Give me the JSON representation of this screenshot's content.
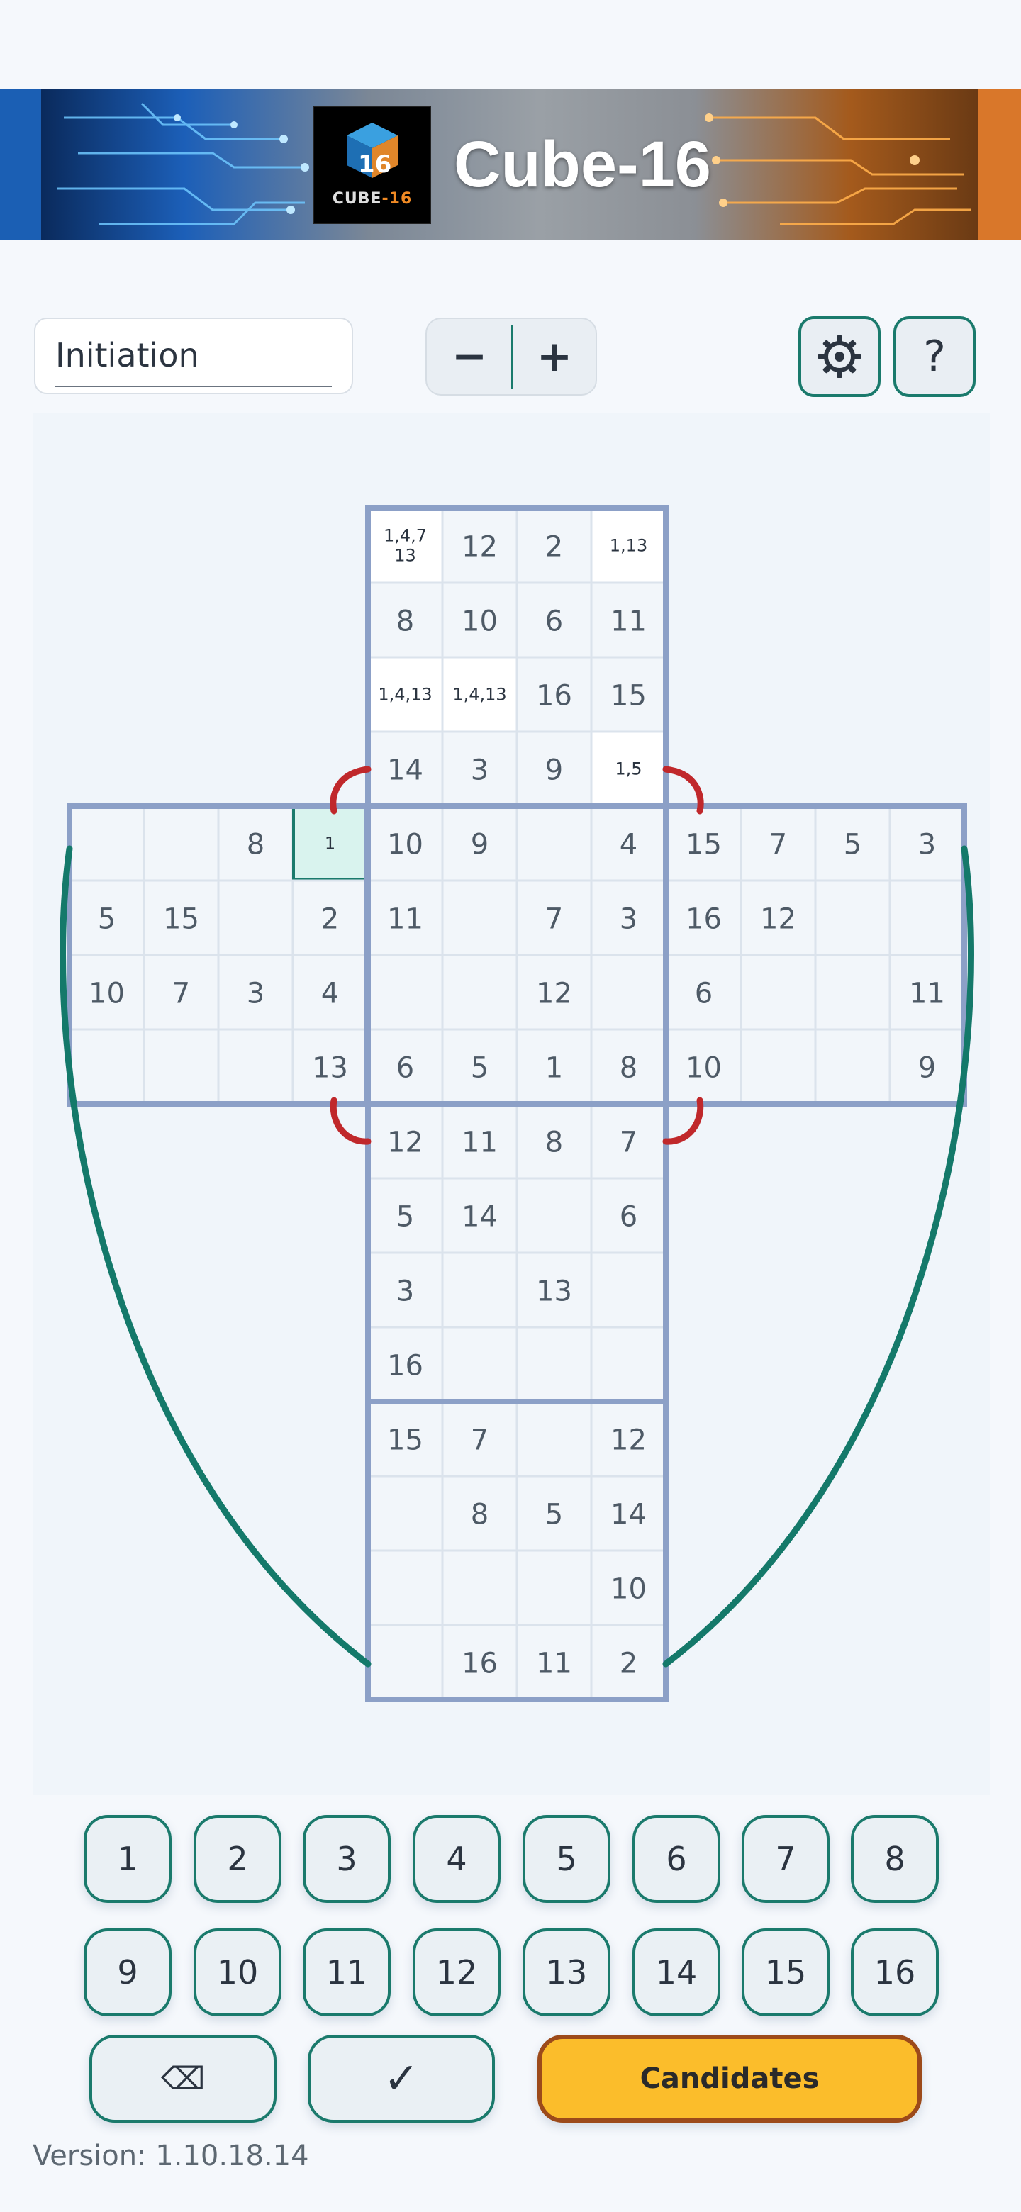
{
  "app": {
    "title": "Cube-16",
    "logo_text_a": "CUBE",
    "logo_text_b": "-16"
  },
  "toolbar": {
    "level_value": "Initiation",
    "zoom_minus_label": "−",
    "zoom_plus_label": "+",
    "settings_icon": "gear-icon",
    "help_label": "?"
  },
  "board": {
    "selected_face": "left",
    "selected_cell": [
      0,
      3
    ],
    "faces": {
      "top": [
        [
          "1,4,7 13",
          "12",
          "2",
          "1,13"
        ],
        [
          "8",
          "10",
          "6",
          "11"
        ],
        [
          "1,4,13",
          "1,4,13",
          "16",
          "15"
        ],
        [
          "14",
          "3",
          "9",
          "1,5"
        ]
      ],
      "left": [
        [
          "",
          "",
          "8",
          "1"
        ],
        [
          "5",
          "15",
          "",
          "2"
        ],
        [
          "10",
          "7",
          "3",
          "4"
        ],
        [
          "",
          "",
          "",
          "13"
        ]
      ],
      "front": [
        [
          "10",
          "9",
          "",
          "4"
        ],
        [
          "11",
          "",
          "7",
          "3"
        ],
        [
          "",
          "",
          "12",
          ""
        ],
        [
          "6",
          "5",
          "1",
          "8"
        ]
      ],
      "right": [
        [
          "15",
          "7",
          "5",
          "3"
        ],
        [
          "16",
          "12",
          "",
          ""
        ],
        [
          "6",
          "",
          "",
          "11"
        ],
        [
          "10",
          "",
          "",
          "9"
        ]
      ],
      "bottom": [
        [
          "12",
          "11",
          "8",
          "7"
        ],
        [
          "5",
          "14",
          "",
          "6"
        ],
        [
          "3",
          "",
          "13",
          ""
        ],
        [
          "16",
          "",
          "",
          ""
        ]
      ],
      "back": [
        [
          "15",
          "7",
          "",
          "12"
        ],
        [
          "",
          "8",
          "5",
          "14"
        ],
        [
          "",
          "",
          "",
          "10"
        ],
        [
          "",
          "16",
          "11",
          "2"
        ]
      ]
    },
    "candidate_cells": [
      "top.0.0",
      "top.0.3",
      "top.2.0",
      "top.2.1",
      "top.3.3",
      "left.0.3"
    ],
    "colors": {
      "grid": "#8ca0c7",
      "cell_bg": "#f2f6fa",
      "given_bg": "#ffffff",
      "selected_bg": "#d9f3ee",
      "selected_border": "#1a7a6c",
      "edge_link_teal": "#14796a",
      "edge_link_red": "#c0282b",
      "digit": "#4e5a66"
    }
  },
  "keypad": {
    "digits": [
      "1",
      "2",
      "3",
      "4",
      "5",
      "6",
      "7",
      "8",
      "9",
      "10",
      "11",
      "12",
      "13",
      "14",
      "15",
      "16"
    ],
    "delete_label": "⌫",
    "confirm_label": "✓",
    "candidates_label": "Candidates"
  },
  "footer": {
    "version": "Version: 1.10.18.14"
  }
}
